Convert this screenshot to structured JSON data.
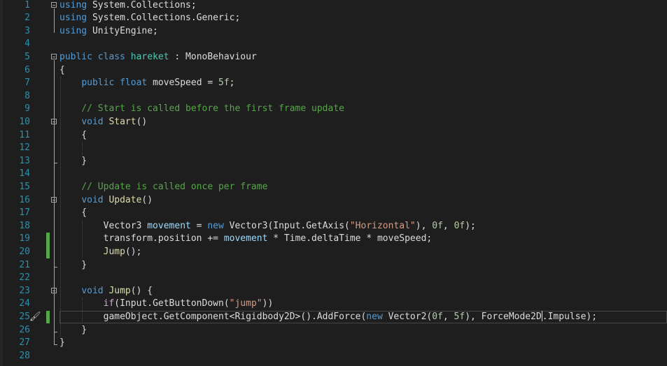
{
  "editor": {
    "lines": [
      {
        "num": "1",
        "tokens": [
          {
            "t": "using",
            "c": "#569cd6"
          },
          {
            "t": " System.Collections;",
            "c": "#dcdcdc"
          }
        ]
      },
      {
        "num": "2",
        "tokens": [
          {
            "t": "using",
            "c": "#569cd6"
          },
          {
            "t": " System.Collections.Generic;",
            "c": "#dcdcdc"
          }
        ]
      },
      {
        "num": "3",
        "tokens": [
          {
            "t": "using",
            "c": "#569cd6"
          },
          {
            "t": " UnityEngine;",
            "c": "#dcdcdc"
          }
        ]
      },
      {
        "num": "4",
        "tokens": []
      },
      {
        "num": "5",
        "tokens": [
          {
            "t": "public",
            "c": "#569cd6"
          },
          {
            "t": " ",
            "c": "#dcdcdc"
          },
          {
            "t": "class",
            "c": "#569cd6"
          },
          {
            "t": " ",
            "c": "#dcdcdc"
          },
          {
            "t": "hareket",
            "c": "#4ec9b0"
          },
          {
            "t": " : MonoBehaviour",
            "c": "#dcdcdc"
          }
        ]
      },
      {
        "num": "6",
        "tokens": [
          {
            "t": "{",
            "c": "#dcdcdc"
          }
        ]
      },
      {
        "num": "7",
        "tokens": [
          {
            "t": "    ",
            "c": "#dcdcdc"
          },
          {
            "t": "public",
            "c": "#569cd6"
          },
          {
            "t": " ",
            "c": "#dcdcdc"
          },
          {
            "t": "float",
            "c": "#569cd6"
          },
          {
            "t": " moveSpeed = ",
            "c": "#dcdcdc"
          },
          {
            "t": "5f",
            "c": "#b5cea8"
          },
          {
            "t": ";",
            "c": "#dcdcdc"
          }
        ]
      },
      {
        "num": "8",
        "tokens": []
      },
      {
        "num": "9",
        "tokens": [
          {
            "t": "    // Start is called before the first frame update",
            "c": "#57a64a"
          }
        ]
      },
      {
        "num": "10",
        "tokens": [
          {
            "t": "    ",
            "c": "#dcdcdc"
          },
          {
            "t": "void",
            "c": "#569cd6"
          },
          {
            "t": " ",
            "c": "#dcdcdc"
          },
          {
            "t": "Start",
            "c": "#dcdcaa"
          },
          {
            "t": "()",
            "c": "#dcdcdc"
          }
        ]
      },
      {
        "num": "11",
        "tokens": [
          {
            "t": "    {",
            "c": "#dcdcdc"
          }
        ]
      },
      {
        "num": "12",
        "tokens": []
      },
      {
        "num": "13",
        "tokens": [
          {
            "t": "    }",
            "c": "#dcdcdc"
          }
        ]
      },
      {
        "num": "14",
        "tokens": []
      },
      {
        "num": "15",
        "tokens": [
          {
            "t": "    // Update is called once per frame",
            "c": "#57a64a"
          }
        ]
      },
      {
        "num": "16",
        "tokens": [
          {
            "t": "    ",
            "c": "#dcdcdc"
          },
          {
            "t": "void",
            "c": "#569cd6"
          },
          {
            "t": " ",
            "c": "#dcdcdc"
          },
          {
            "t": "Update",
            "c": "#dcdcaa"
          },
          {
            "t": "()",
            "c": "#dcdcdc"
          }
        ]
      },
      {
        "num": "17",
        "tokens": [
          {
            "t": "    {",
            "c": "#dcdcdc"
          }
        ]
      },
      {
        "num": "18",
        "tokens": [
          {
            "t": "        Vector3 ",
            "c": "#dcdcdc"
          },
          {
            "t": "movement",
            "c": "#9cdcfe"
          },
          {
            "t": " = ",
            "c": "#dcdcdc"
          },
          {
            "t": "new",
            "c": "#569cd6"
          },
          {
            "t": " Vector3(Input.GetAxis(",
            "c": "#dcdcdc"
          },
          {
            "t": "\"Horizontal\"",
            "c": "#d69d85"
          },
          {
            "t": "), ",
            "c": "#dcdcdc"
          },
          {
            "t": "0f",
            "c": "#b5cea8"
          },
          {
            "t": ", ",
            "c": "#dcdcdc"
          },
          {
            "t": "0f",
            "c": "#b5cea8"
          },
          {
            "t": ");",
            "c": "#dcdcdc"
          }
        ]
      },
      {
        "num": "19",
        "tokens": [
          {
            "t": "        transform.position += ",
            "c": "#dcdcdc"
          },
          {
            "t": "movement",
            "c": "#9cdcfe"
          },
          {
            "t": " * Time.deltaTime * moveSpeed;",
            "c": "#dcdcdc"
          }
        ]
      },
      {
        "num": "20",
        "tokens": [
          {
            "t": "        ",
            "c": "#dcdcdc"
          },
          {
            "t": "Jump",
            "c": "#dcdcaa"
          },
          {
            "t": "();",
            "c": "#dcdcdc"
          }
        ]
      },
      {
        "num": "21",
        "tokens": [
          {
            "t": "    }",
            "c": "#dcdcdc"
          }
        ]
      },
      {
        "num": "22",
        "tokens": []
      },
      {
        "num": "23",
        "tokens": [
          {
            "t": "    ",
            "c": "#dcdcdc"
          },
          {
            "t": "void",
            "c": "#569cd6"
          },
          {
            "t": " ",
            "c": "#dcdcdc"
          },
          {
            "t": "Jump",
            "c": "#dcdcaa"
          },
          {
            "t": "() {",
            "c": "#dcdcdc"
          }
        ]
      },
      {
        "num": "24",
        "tokens": [
          {
            "t": "        ",
            "c": "#dcdcdc"
          },
          {
            "t": "if",
            "c": "#d8a0df"
          },
          {
            "t": "(Input.GetButtonDown(",
            "c": "#dcdcdc"
          },
          {
            "t": "\"jump\"",
            "c": "#d69d85"
          },
          {
            "t": "))",
            "c": "#dcdcdc"
          }
        ]
      },
      {
        "num": "25",
        "tokens": [
          {
            "t": "        gameObject.GetComponent<Rigidbody2D>().AddForce(",
            "c": "#dcdcdc"
          },
          {
            "t": "new",
            "c": "#569cd6"
          },
          {
            "t": " Vector2(",
            "c": "#dcdcdc"
          },
          {
            "t": "0f",
            "c": "#b5cea8"
          },
          {
            "t": ", ",
            "c": "#dcdcdc"
          },
          {
            "t": "5f",
            "c": "#b5cea8"
          },
          {
            "t": "), ForceMode2D",
            "c": "#dcdcdc"
          },
          {
            "t": "|",
            "c": "caret"
          },
          {
            "t": ".Impulse);",
            "c": "#dcdcdc"
          }
        ]
      },
      {
        "num": "26",
        "tokens": [
          {
            "t": "    }",
            "c": "#dcdcdc"
          }
        ]
      },
      {
        "num": "27",
        "tokens": [
          {
            "t": "}",
            "c": "#dcdcdc"
          }
        ]
      },
      {
        "num": "28",
        "tokens": []
      }
    ],
    "fold_lines": [
      "1",
      "5",
      "10",
      "16",
      "23"
    ],
    "changed_lines": [
      "19",
      "20",
      "25"
    ],
    "current_line": "25",
    "quick_action_icon": "paintbrush-icon",
    "colors": {
      "background": "#1e1e1e",
      "line_number": "#2b91af",
      "keyword": "#569cd6",
      "type": "#4ec9b0",
      "method": "#dcdcaa",
      "string": "#d69d85",
      "number": "#b5cea8",
      "comment": "#57a64a",
      "variable": "#9cdcfe",
      "control": "#d8a0df",
      "change_marker": "#57a64a"
    }
  }
}
